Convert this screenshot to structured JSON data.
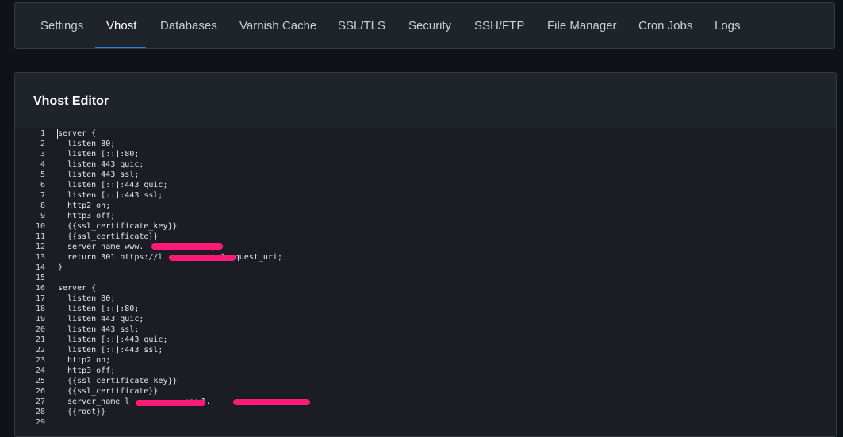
{
  "tabs": [
    {
      "label": "Settings",
      "active": false
    },
    {
      "label": "Vhost",
      "active": true
    },
    {
      "label": "Databases",
      "active": false
    },
    {
      "label": "Varnish Cache",
      "active": false
    },
    {
      "label": "SSL/TLS",
      "active": false
    },
    {
      "label": "Security",
      "active": false
    },
    {
      "label": "SSH/FTP",
      "active": false
    },
    {
      "label": "File Manager",
      "active": false
    },
    {
      "label": "Cron Jobs",
      "active": false
    },
    {
      "label": "Logs",
      "active": false
    }
  ],
  "editor": {
    "title": "Vhost Editor",
    "lines": [
      {
        "n": "1",
        "text": "server {"
      },
      {
        "n": "2",
        "text": "  listen 80;"
      },
      {
        "n": "3",
        "text": "  listen [::]:80;"
      },
      {
        "n": "4",
        "text": "  listen 443 quic;"
      },
      {
        "n": "5",
        "text": "  listen 443 ssl;"
      },
      {
        "n": "6",
        "text": "  listen [::]:443 quic;"
      },
      {
        "n": "7",
        "text": "  listen [::]:443 ssl;"
      },
      {
        "n": "8",
        "text": "  http2 on;"
      },
      {
        "n": "9",
        "text": "  http3 off;"
      },
      {
        "n": "10",
        "text": "  {{ssl_certificate_key}}"
      },
      {
        "n": "11",
        "text": "  {{ssl_certificate}}"
      },
      {
        "n": "12",
        "text": "  server_name www.              ;"
      },
      {
        "n": "13",
        "text": "  return 301 https://l            $request_uri;"
      },
      {
        "n": "14",
        "text": "}"
      },
      {
        "n": "15",
        "text": ""
      },
      {
        "n": "16",
        "text": "server {"
      },
      {
        "n": "17",
        "text": "  listen 80;"
      },
      {
        "n": "18",
        "text": "  listen [::]:80;"
      },
      {
        "n": "19",
        "text": "  listen 443 quic;"
      },
      {
        "n": "20",
        "text": "  listen 443 ssl;"
      },
      {
        "n": "21",
        "text": "  listen [::]:443 quic;"
      },
      {
        "n": "22",
        "text": "  listen [::]:443 ssl;"
      },
      {
        "n": "23",
        "text": "  http2 on;"
      },
      {
        "n": "24",
        "text": "  http3 off;"
      },
      {
        "n": "25",
        "text": "  {{ssl_certificate_key}}"
      },
      {
        "n": "26",
        "text": "  {{ssl_certificate}}"
      },
      {
        "n": "27",
        "text": "  server_name l            www1.                "
      },
      {
        "n": "28",
        "text": "  {{root}}"
      },
      {
        "n": "29",
        "text": ""
      }
    ]
  },
  "colors": {
    "accent": "#2f7fd0",
    "redaction": "#ff1a77"
  }
}
